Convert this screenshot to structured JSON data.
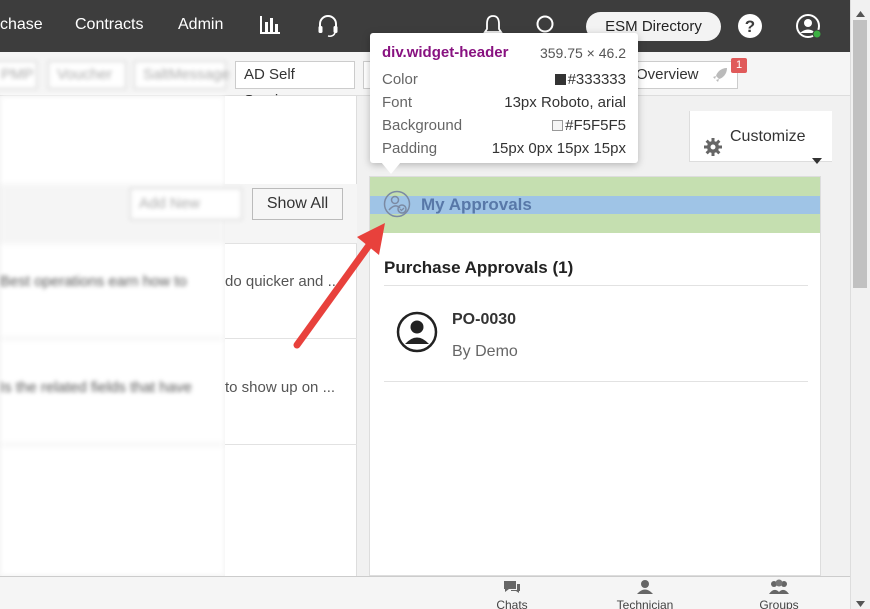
{
  "nav": {
    "purchase": "chase",
    "contracts": "Contracts",
    "admin": "Admin",
    "esm_directory": "ESM Directory"
  },
  "toolbar": {
    "blurred_1": "PMP",
    "blurred_2": "Voucher",
    "blurred_3": "SaltMessage",
    "ad_self_service": "AD Self Service",
    "overview": "Overview",
    "badge_count": "1"
  },
  "left_panel": {
    "add_new": "Add New",
    "show_all": "Show All",
    "row1_blurred": "Best operations earn how to",
    "row1_text": "do quicker and ...",
    "row2_blurred": "Is the related fields that have",
    "row2_text": "to show up on ..."
  },
  "customize": {
    "label": "Customize"
  },
  "widget": {
    "title": "My Approvals",
    "section_title": "Purchase Approvals (1)",
    "items": [
      {
        "id": "PO-0030",
        "by": "By Demo"
      }
    ]
  },
  "tooltip": {
    "selector": "div.widget-header",
    "dimensions": "359.75 × 46.2",
    "rows": [
      {
        "label": "Color",
        "value": "#333333",
        "swatch": "#333333"
      },
      {
        "label": "Font",
        "value": "13px Roboto, arial"
      },
      {
        "label": "Background",
        "value": "#F5F5F5",
        "swatch": "#F5F5F5"
      },
      {
        "label": "Padding",
        "value": "15px 0px 15px 15px"
      }
    ]
  },
  "bottom_bar": {
    "chats": "Chats",
    "technician": "Technician",
    "groups": "Groups"
  },
  "colors": {
    "navbar": "#3d3d3d",
    "annotation_arrow": "#e8413c",
    "widget_header_highlight": "#c5dfb0",
    "content_highlight": "#9fc4e6"
  }
}
